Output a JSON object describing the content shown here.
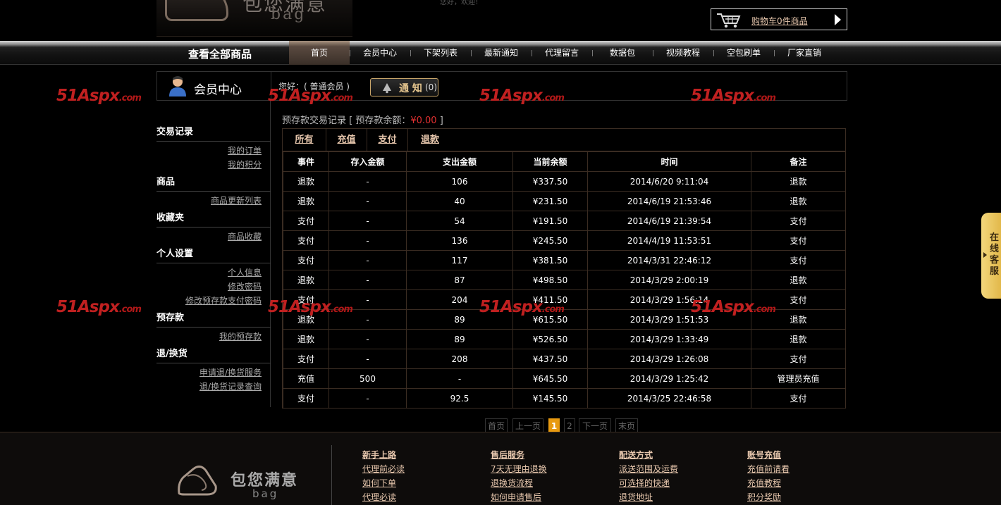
{
  "header": {
    "logo_text": "包您满意",
    "logo_sub": "bag",
    "tiny_text": "您好，欢迎！",
    "cart_text": "购物车0件商品"
  },
  "nav": {
    "all_products": "查看全部商品",
    "items": [
      "首页",
      "会员中心",
      "下架列表",
      "最新通知",
      "代理留言",
      "数据包",
      "视频教程",
      "空包刷单",
      "厂家直销"
    ],
    "active_index": 0
  },
  "member": {
    "title": "会员中心",
    "hello": "您好：( 普通会员 )",
    "notice_label": "通 知",
    "notice_count": "(0)"
  },
  "sidebar": {
    "sections": [
      {
        "head": "交易记录",
        "links": [
          "我的订单",
          "我的积分"
        ]
      },
      {
        "head": "商品",
        "links": [
          "商品更新列表"
        ]
      },
      {
        "head": "收藏夹",
        "links": [
          "商品收藏"
        ]
      },
      {
        "head": "个人设置",
        "links": [
          "个人信息",
          "修改密码",
          "修改预存款支付密码"
        ]
      },
      {
        "head": "预存款",
        "links": [
          "我的预存款"
        ]
      },
      {
        "head": "退/换货",
        "links": [
          "申请退/换货服务",
          "退/换货记录查询"
        ]
      }
    ]
  },
  "main": {
    "title_prefix": "预存款交易记录 [ 预存款余额：",
    "balance": "¥0.00",
    "title_suffix": " ]",
    "tabs": [
      "所有",
      "充值",
      "支付",
      "退款"
    ],
    "columns": [
      "事件",
      "存入金额",
      "支出金额",
      "当前余额",
      "时间",
      "备注"
    ],
    "rows": [
      [
        "退款",
        "-",
        "106",
        "¥337.50",
        "2014/6/20 9:11:04",
        "退款"
      ],
      [
        "退款",
        "-",
        "40",
        "¥231.50",
        "2014/6/19 21:53:46",
        "退款"
      ],
      [
        "支付",
        "-",
        "54",
        "¥191.50",
        "2014/6/19 21:39:54",
        "支付"
      ],
      [
        "支付",
        "-",
        "136",
        "¥245.50",
        "2014/4/19 11:53:51",
        "支付"
      ],
      [
        "支付",
        "-",
        "117",
        "¥381.50",
        "2014/3/31 22:46:12",
        "支付"
      ],
      [
        "退款",
        "-",
        "87",
        "¥498.50",
        "2014/3/29 2:00:19",
        "退款"
      ],
      [
        "支付",
        "-",
        "204",
        "¥411.50",
        "2014/3/29 1:56:14",
        "支付"
      ],
      [
        "退款",
        "-",
        "89",
        "¥615.50",
        "2014/3/29 1:51:53",
        "退款"
      ],
      [
        "退款",
        "-",
        "89",
        "¥526.50",
        "2014/3/29 1:33:49",
        "退款"
      ],
      [
        "支付",
        "-",
        "208",
        "¥437.50",
        "2014/3/29 1:26:08",
        "支付"
      ],
      [
        "充值",
        "500",
        "-",
        "¥645.50",
        "2014/3/29 1:25:42",
        "管理员充值"
      ],
      [
        "支付",
        "-",
        "92.5",
        "¥145.50",
        "2014/3/25 22:46:58",
        "支付"
      ]
    ]
  },
  "pager": {
    "first": "首页",
    "prev": "上一页",
    "pages": [
      "1",
      "2"
    ],
    "current": "1",
    "next": "下一页",
    "last": "末页"
  },
  "footer": {
    "logo_text": "包您满意",
    "logo_sub": "bag",
    "columns": [
      {
        "head": "新手上路",
        "links": [
          "代理前必读",
          "如何下单",
          "代理必读"
        ]
      },
      {
        "head": "售后服务",
        "links": [
          "7天无理由退换",
          "退换货流程",
          "如何申请售后"
        ]
      },
      {
        "head": "配送方式",
        "links": [
          "派送范围及运费",
          "可选择的快递",
          "退货地址"
        ]
      },
      {
        "head": "账号充值",
        "links": [
          "充值前请看",
          "充值教程",
          "积分奖励"
        ]
      }
    ]
  },
  "watermark": {
    "main": "51Aspx",
    "suffix": ".com"
  },
  "online_service": "在线客服",
  "colors": {
    "accent": "#e8c8ae",
    "balance_red": "#e03030",
    "pager_current": "#e89a10",
    "service_tab": "#e2b84a"
  }
}
